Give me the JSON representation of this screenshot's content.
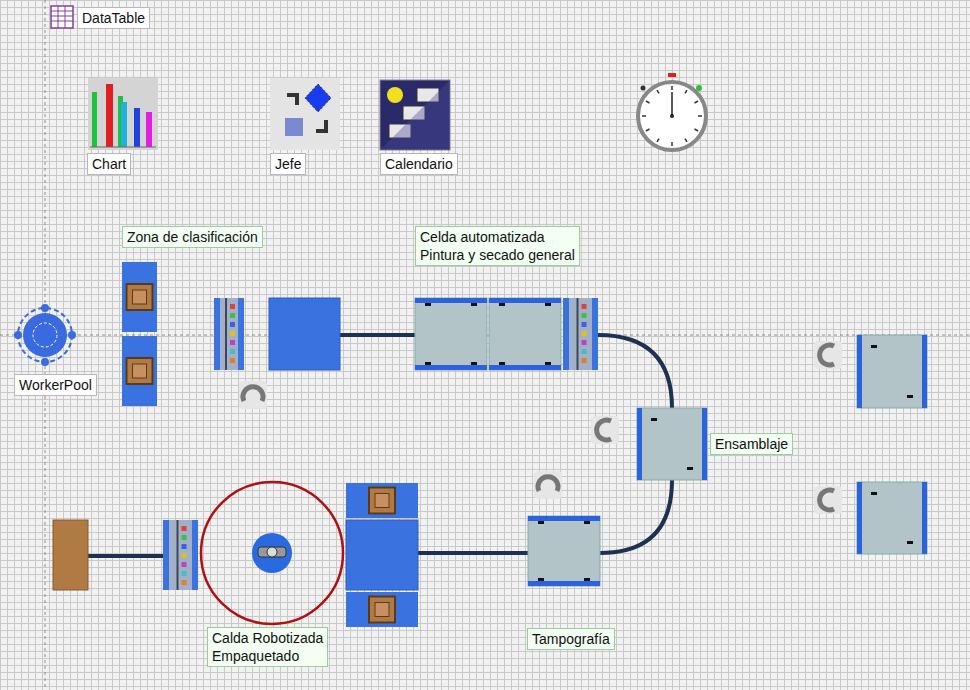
{
  "tools": [
    {
      "label": "DataTable"
    },
    {
      "label": "Chart"
    },
    {
      "label": "Jefe"
    },
    {
      "label": "Calendario"
    },
    {
      "label": "WorkerPool"
    }
  ],
  "areas": [
    {
      "lines": [
        "Zona de clasificación"
      ]
    },
    {
      "lines": [
        "Celda automatizada",
        "Pintura y secado general"
      ]
    },
    {
      "lines": [
        "Ensamblaje"
      ]
    },
    {
      "lines": [
        "Calda Robotizada",
        "Empaquetado"
      ]
    },
    {
      "lines": [
        "Tampografía"
      ]
    }
  ]
}
